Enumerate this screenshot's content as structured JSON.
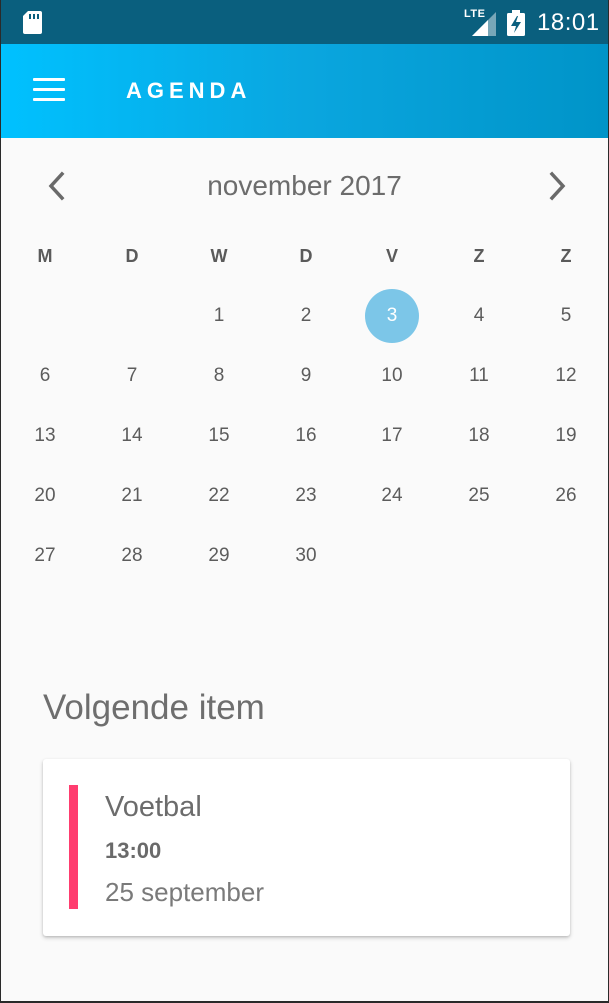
{
  "status_bar": {
    "network_label": "LTE",
    "time": "18:01",
    "icons": [
      "sd-card-icon",
      "signal-icon",
      "battery-charging-icon"
    ],
    "background": "#0a5f7e"
  },
  "app_bar": {
    "menu_icon": "hamburger-menu-icon",
    "title": "AGENDA",
    "gradient_start": "#00c1ff",
    "gradient_end": "#0094c8"
  },
  "calendar": {
    "month_label": "november 2017",
    "prev_icon": "chevron-left-icon",
    "next_icon": "chevron-right-icon",
    "weekdays": [
      "M",
      "D",
      "W",
      "D",
      "V",
      "Z",
      "Z"
    ],
    "weeks": [
      [
        "",
        "",
        "1",
        "2",
        "3",
        "4",
        "5"
      ],
      [
        "6",
        "7",
        "8",
        "9",
        "10",
        "11",
        "12"
      ],
      [
        "13",
        "14",
        "15",
        "16",
        "17",
        "18",
        "19"
      ],
      [
        "20",
        "21",
        "22",
        "23",
        "24",
        "25",
        "26"
      ],
      [
        "27",
        "28",
        "29",
        "30",
        "",
        "",
        ""
      ]
    ],
    "selected_day": "3",
    "selected_color": "#7cc6e8"
  },
  "next_item": {
    "section_title": "Volgende item",
    "title": "Voetbal",
    "time": "13:00",
    "date": "25 september",
    "accent_color": "#ff3d6f"
  }
}
